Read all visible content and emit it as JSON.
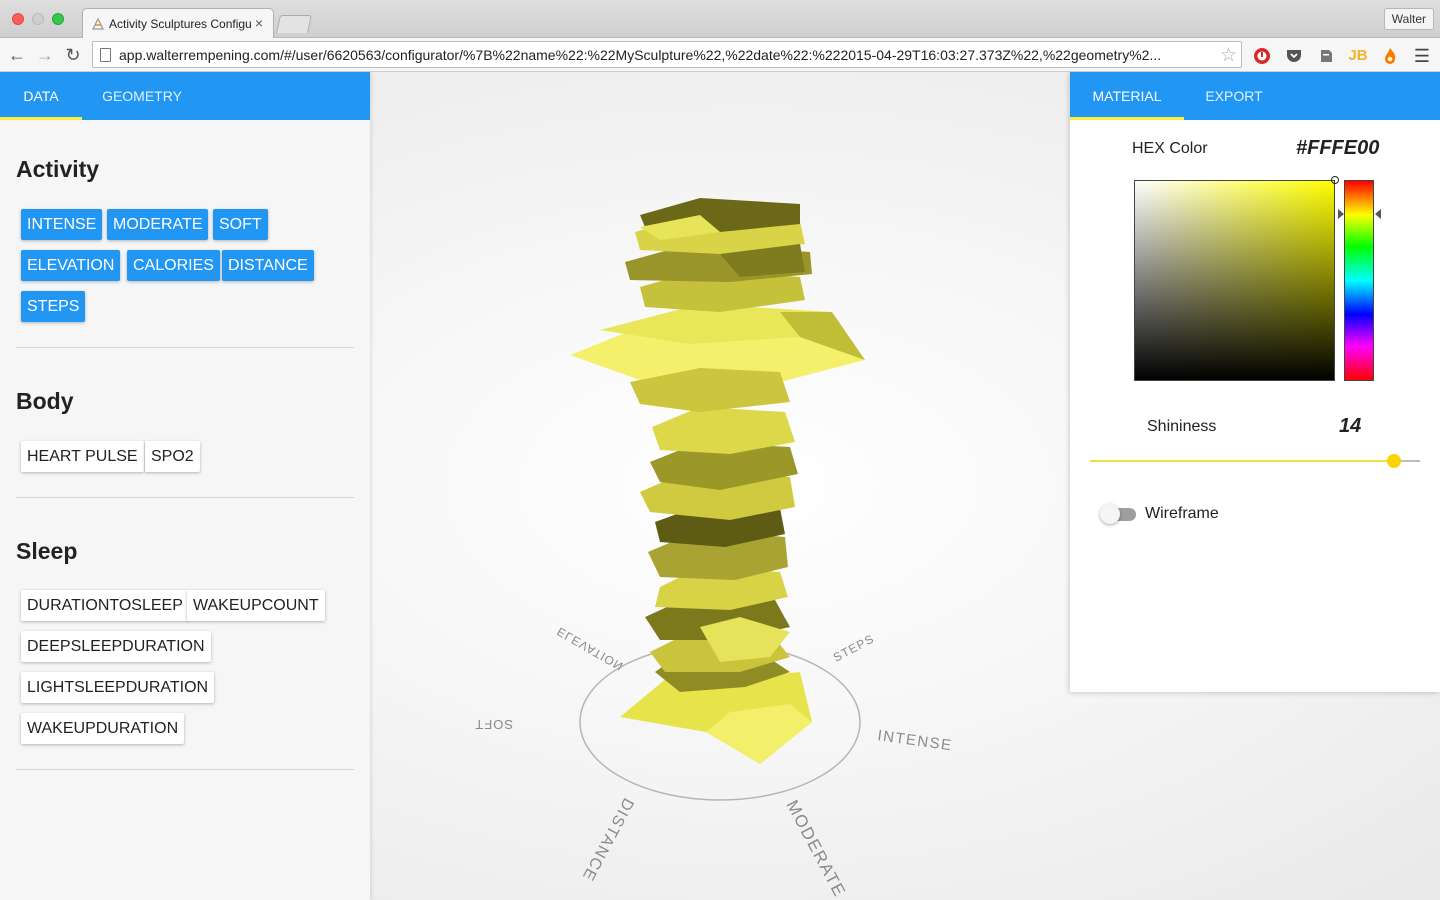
{
  "browser": {
    "tab_title": "Activity Sculptures Configu",
    "tab_close": "×",
    "url": "app.walterrempening.com/#/user/6620563/configurator/%7B%22name%22:%22MySculpture%22,%22date%22:%222015-04-29T16:03:27.373Z%22,%22geometry%2...",
    "profile_name": "Walter",
    "back_icon": "back-arrow-icon",
    "forward_icon": "forward-arrow-icon",
    "reload_icon": "reload-icon",
    "bookmark_icon": "star-icon",
    "menu_icon": "hamburger-menu-icon"
  },
  "left_panel": {
    "tabs": [
      {
        "label": "DATA",
        "active": true
      },
      {
        "label": "GEOMETRY",
        "active": false
      }
    ],
    "sections": [
      {
        "title": "Activity",
        "chips": [
          "INTENSE",
          "MODERATE",
          "SOFT",
          "ELEVATION",
          "CALORIES",
          "DISTANCE",
          "STEPS"
        ],
        "selected": true
      },
      {
        "title": "Body",
        "chips": [
          "HEART PULSE",
          "SPO2"
        ],
        "selected": false
      },
      {
        "title": "Sleep",
        "chips": [
          "DURATIONTOSLEEP",
          "WAKEUPCOUNT",
          "DEEPSLEEPDURATION",
          "LIGHTSLEEPDURATION",
          "WAKEUPDURATION"
        ],
        "selected": false
      }
    ]
  },
  "right_panel": {
    "tabs": [
      {
        "label": "MATERIAL",
        "active": true
      },
      {
        "label": "EXPORT",
        "active": false
      }
    ],
    "hex_label": "HEX Color",
    "hex_value": "#FFFE00",
    "shininess_label": "Shininess",
    "shininess_value": "14",
    "shininess_fraction": 0.92,
    "wireframe_label": "Wireframe",
    "wireframe_on": false
  },
  "scene": {
    "sculpture_color": "#f5f06a",
    "axis_labels": [
      "ELEVATION",
      "STEPS",
      "SOFT",
      "INTENSE",
      "DISTANCE",
      "MODERATE"
    ]
  },
  "colors": {
    "accent_blue": "#2196f3",
    "tab_indicator": "#ffeb3b",
    "slider": "#fbd400"
  }
}
